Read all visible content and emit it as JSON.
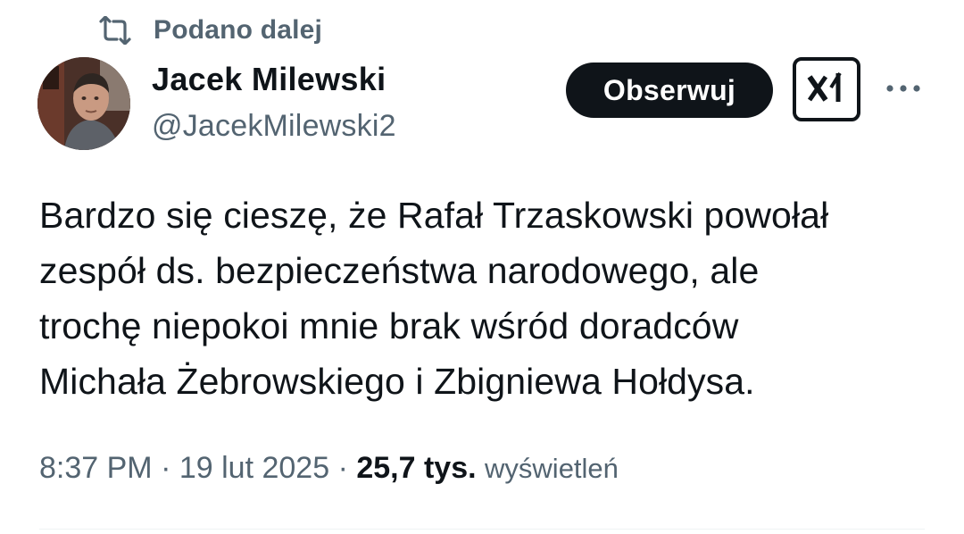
{
  "repost": {
    "label": "Podano dalej",
    "icon": "repost-icon"
  },
  "author": {
    "display_name": "Jacek Milewski",
    "handle": "@JacekMilewski2",
    "avatar_icon": "avatar"
  },
  "actions": {
    "follow_label": "Obserwuj",
    "grok_icon": "grok-icon",
    "more_icon": "more-icon"
  },
  "tweet": {
    "lines": [
      "Bardzo się cieszę, że Rafał Trzaskowski powołał",
      "zespół ds. bezpieczeństwa narodowego, ale",
      "trochę niepokoi mnie brak wśród doradców",
      "Michała Żebrowskiego i Zbigniewa Hołdysa."
    ]
  },
  "meta": {
    "time": "8:37 PM",
    "separator": "·",
    "date": "19 lut 2025",
    "views_count": "25,7 tys.",
    "views_label": "wyświetleń"
  },
  "colors": {
    "text_primary": "#0f1419",
    "text_secondary": "#536471",
    "button_bg": "#0f1419",
    "divider": "#eff3f4"
  }
}
